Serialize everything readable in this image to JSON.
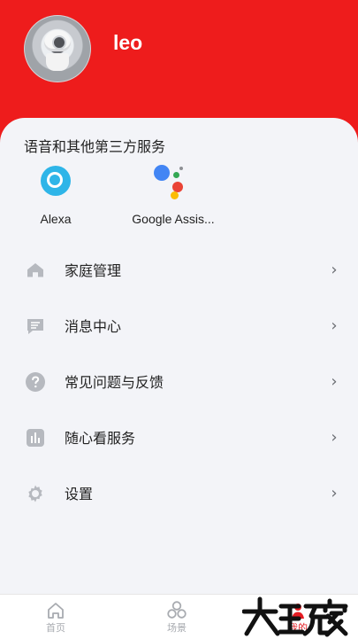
{
  "profile": {
    "username": "leo"
  },
  "services_section": {
    "title": "语音和其他第三方服务",
    "items": [
      {
        "label": "Alexa",
        "icon": "alexa-icon"
      },
      {
        "label": "Google Assis...",
        "icon": "google-assistant-icon"
      }
    ]
  },
  "menu": {
    "items": [
      {
        "label": "家庭管理",
        "icon": "home-icon"
      },
      {
        "label": "消息中心",
        "icon": "message-icon"
      },
      {
        "label": "常见问题与反馈",
        "icon": "help-icon"
      },
      {
        "label": "随心看服务",
        "icon": "chart-icon"
      },
      {
        "label": "设置",
        "icon": "settings-icon"
      }
    ]
  },
  "tabbar": {
    "items": [
      {
        "label": "首页",
        "icon": "home-tab-icon"
      },
      {
        "label": "场景",
        "icon": "scene-tab-icon"
      },
      {
        "label": "我的",
        "icon": "profile-tab-icon"
      }
    ],
    "active_index": 2
  },
  "watermark": {
    "text": "大玩家"
  },
  "colors": {
    "header": "#ee1c1c",
    "background": "#f3f4f8",
    "icon_gray": "#b6b9bf",
    "active": "#e51c23"
  }
}
